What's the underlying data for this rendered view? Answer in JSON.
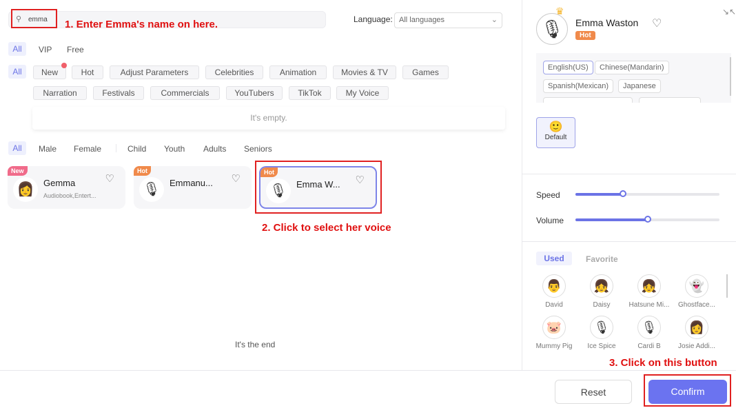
{
  "search": {
    "value": "emma",
    "annotation": "1. Enter Emma's name on here."
  },
  "language": {
    "label": "Language:",
    "selected": "All languages"
  },
  "tier_filters": [
    "All",
    "VIP",
    "Free"
  ],
  "categories": {
    "all": "All",
    "items": [
      "New",
      "Hot",
      "Adjust Parameters",
      "Celebrities",
      "Animation",
      "Movies & TV",
      "Games",
      "Narration",
      "Festivals",
      "Commercials",
      "YouTubers",
      "TikTok",
      "My Voice"
    ]
  },
  "empty_text": "It's empty.",
  "demographic_filters": [
    "All",
    "Male",
    "Female",
    "Child",
    "Youth",
    "Adults",
    "Seniors"
  ],
  "voices": [
    {
      "badge": "New",
      "name": "Gemma",
      "sub": "Audiobook,Entert..."
    },
    {
      "badge": "Hot",
      "name": "Emmanu..."
    },
    {
      "badge": "Hot",
      "name": "Emma W..."
    }
  ],
  "select_annotation": "2. Click to select her voice",
  "end_text": "It's the end",
  "detail": {
    "name": "Emma Waston",
    "badge": "Hot",
    "languages": [
      "English(US)",
      "Chinese(Mandarin)",
      "Spanish(Mexican)",
      "Japanese"
    ],
    "emotion": "Default",
    "speed_label": "Speed",
    "speed": 0.33,
    "volume_label": "Volume",
    "volume": 0.5
  },
  "tabs": {
    "used": "Used",
    "favorite": "Favorite"
  },
  "recent": [
    "David",
    "Daisy",
    "Hatsune Mi...",
    "Ghostface...",
    "Mummy Pig",
    "Ice Spice",
    "Cardi B",
    "Josie Addi..."
  ],
  "footer": {
    "reset": "Reset",
    "confirm": "Confirm",
    "annotation": "3. Click on this button"
  },
  "colors": {
    "accent": "#6b73e6",
    "hot": "#f08a4b",
    "new": "#f06b8a",
    "annotation": "#e01010"
  }
}
